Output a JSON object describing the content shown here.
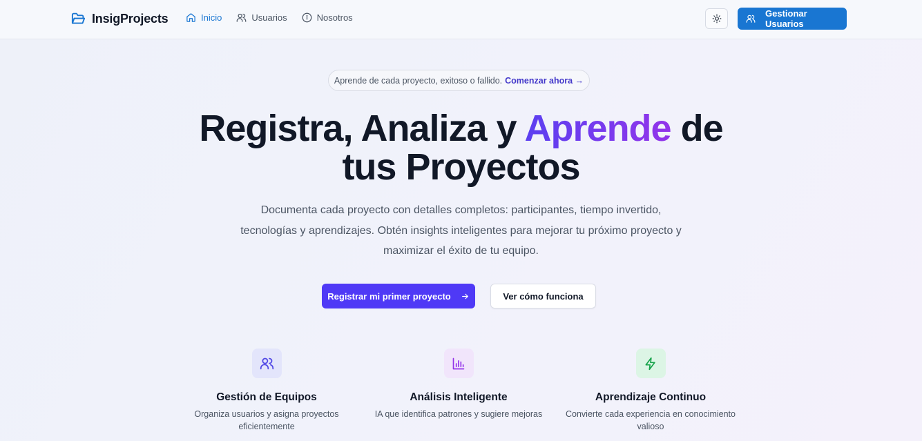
{
  "brand": {
    "name": "InsigProjects",
    "icon": "folder-open-icon",
    "color": "#1976d2"
  },
  "nav": {
    "items": [
      {
        "label": "Inicio",
        "icon": "home-icon",
        "active": true
      },
      {
        "label": "Usuarios",
        "icon": "users-icon",
        "active": false
      },
      {
        "label": "Nosotros",
        "icon": "info-icon",
        "active": false
      }
    ],
    "theme_toggle_icon": "sun-icon",
    "manage_users_label": "Gestionar Usuarios"
  },
  "hero": {
    "pill_text": "Aprende de cada proyecto, exitoso o fallido.",
    "pill_link": "Comenzar ahora →",
    "title_part1": "Registra, Analiza y ",
    "title_highlight": "Aprende",
    "title_part2": " de",
    "title_line2": "tus Proyectos",
    "subtitle": "Documenta cada proyecto con detalles completos: participantes, tiempo invertido, tecnologías y aprendizajes. Obtén insights inteligentes para mejorar tu próximo proyecto y maximizar el éxito de tu equipo.",
    "cta_primary": "Registrar mi primer proyecto",
    "cta_secondary": "Ver cómo funciona"
  },
  "features": [
    {
      "title": "Gestión de Equipos",
      "desc": "Organiza usuarios y asigna proyectos eficientemente",
      "icon": "users-icon",
      "color": "#4f46e5",
      "bg": "#e3e5fb"
    },
    {
      "title": "Análisis Inteligente",
      "desc": "IA que identifica patrones y sugiere mejoras",
      "icon": "bar-chart-icon",
      "color": "#9333ea",
      "bg": "#f1e5fb"
    },
    {
      "title": "Aprendizaje Continuo",
      "desc": "Convierte cada experiencia en conocimiento valioso",
      "icon": "zap-icon",
      "color": "#16a34a",
      "bg": "#dcf5e5"
    }
  ],
  "colors": {
    "primary": "#4f39f6",
    "accent_blue": "#1976d2"
  }
}
